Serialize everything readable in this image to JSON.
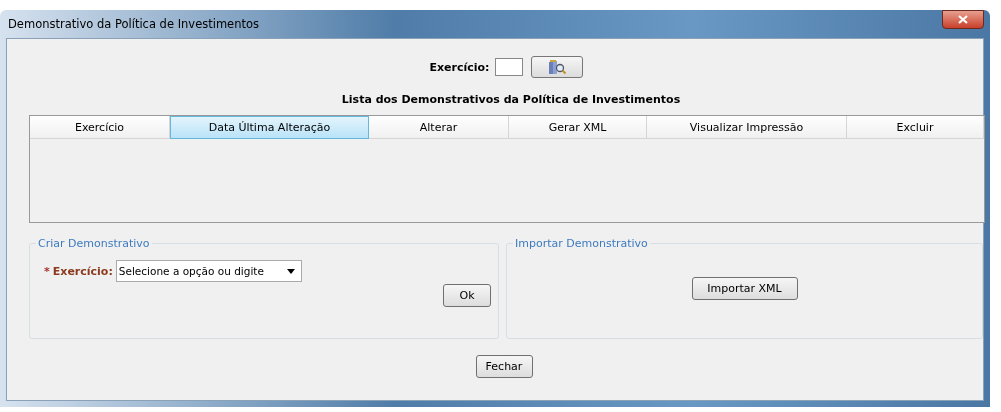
{
  "window": {
    "title": "Demonstrativo da Política de Investimentos"
  },
  "search": {
    "label": "Exercício:"
  },
  "table": {
    "title": "Lista dos Demonstrativos da Política de Investimentos",
    "columns": [
      {
        "label": "Exercício",
        "selected": false
      },
      {
        "label": "Data Última Alteração",
        "selected": true
      },
      {
        "label": "Alterar",
        "selected": false
      },
      {
        "label": "Gerar XML",
        "selected": false
      },
      {
        "label": "Visualizar Impressão",
        "selected": false
      },
      {
        "label": "Excluir",
        "selected": false
      }
    ]
  },
  "create_group": {
    "title": "Criar Demonstrativo",
    "required_mark": "*",
    "label": "Exercício:",
    "placeholder": "Selecione a opção ou digite",
    "button": "Ok"
  },
  "import_group": {
    "title": "Importar Demonstrativo",
    "button": "Importar XML"
  },
  "buttons": [
    "Fechar"
  ]
}
